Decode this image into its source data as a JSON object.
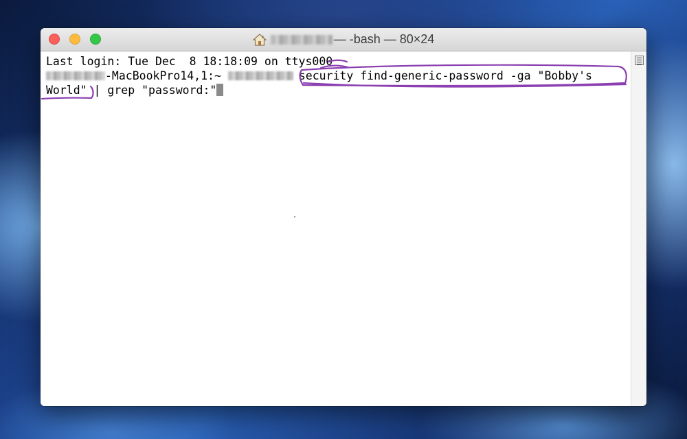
{
  "window": {
    "title_rest": "— -bash — 80×24",
    "buttons": [
      "close",
      "minimize",
      "zoom"
    ],
    "title_icon": "home-icon"
  },
  "terminal": {
    "line1": "Last login: Tue Dec  8 18:18:09 on ttys000",
    "line2_host_suffix": "-MacBookPro14,1:~",
    "line2_command": "security find-generic-password -ga \"Bobby's",
    "line3_text": "World\" | grep \"password:\""
  },
  "annotation_color": "#8b3fb0"
}
